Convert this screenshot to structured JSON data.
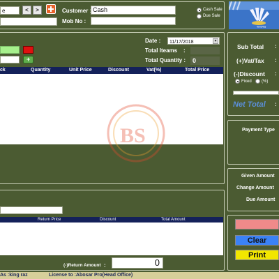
{
  "header": {
    "combo_value": "e",
    "nav_prev": "<",
    "nav_next": ">",
    "customer_label": "Customer :",
    "customer_value": "Cash",
    "mob_label": "Mob No :",
    "mob_value": "",
    "sale_options": [
      "Cash Sale",
      "Due Sale"
    ],
    "selected_sale": "Cash Sale"
  },
  "entry": {
    "date_label": "Date :",
    "date_value": "11/17/2018",
    "total_items_label": "Total Iteams",
    "total_items_colon": ":",
    "total_items_value": "",
    "total_quantity_label": "Total Quantity :",
    "total_quantity_value": "0",
    "add_button": "+",
    "columns": [
      "ck",
      "Quantity",
      "Unit Price",
      "Discount",
      "Vat(%)",
      "Total Price"
    ],
    "rows": []
  },
  "summary": {
    "sub_total_label": "Sub Total",
    "vat_label": "(+)Vat/Tax",
    "discount_label": "(-)Discount",
    "discount_options": [
      "Fixed",
      "(%)"
    ],
    "selected_discount": "Fixed",
    "net_total_label": "Net Total",
    "colon": ":"
  },
  "payment": {
    "payment_type_label": "Payment Type"
  },
  "amounts": {
    "given_label": "Given Amount",
    "change_label": "Change Amount",
    "due_label": "Due Amount"
  },
  "actions": {
    "clear_label": "Clear",
    "print_label": "Print",
    "colors": {
      "top_button": "#f08a8a",
      "clear": "#3b82f6",
      "print": "#f2e600"
    }
  },
  "returns": {
    "columns": [
      "Return Price",
      "Discount",
      "Total Amount"
    ],
    "rows": [],
    "return_amount_label": "(-)Return Amount",
    "return_colon": ":",
    "return_amount_value": "0"
  },
  "status": {
    "user_text": "As :king raz",
    "license_text": "License to :Abosar Pro(Head Office)"
  },
  "colors": {
    "background": "#4b5b32",
    "table_header": "#14215a",
    "net_total": "#5b8fd9",
    "entry_field": "#a6f08c",
    "red_button": "#e01010",
    "status_bar": "#d7cf9a"
  }
}
